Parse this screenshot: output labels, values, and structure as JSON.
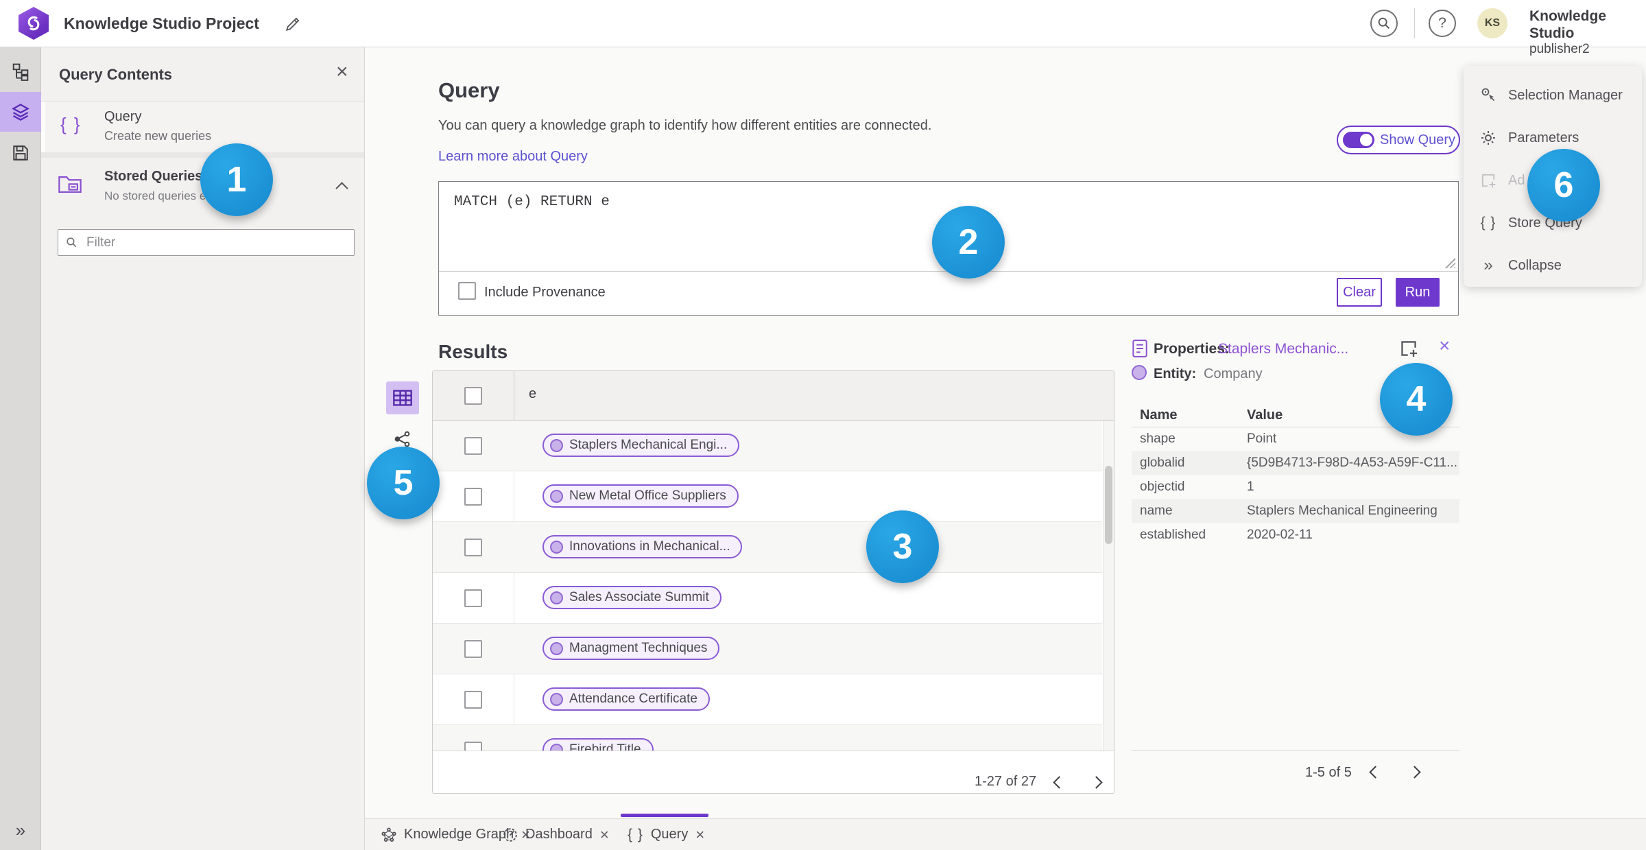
{
  "colors": {
    "accent_purple": "#6e38cc",
    "entity_purple": "#8a4fd0",
    "link_purple": "#5c52d0",
    "badge_blue": "#1e97dc",
    "avatar_yellow": "#eee9c2",
    "rail_active_bg": "#c7b0ef"
  },
  "topbar": {
    "title": "Knowledge Studio Project",
    "user_initials": "KS",
    "user_name": "Knowledge Studio",
    "user_role": "publisher2"
  },
  "contents_panel": {
    "title": "Query Contents",
    "close": "×",
    "query_label": "Query",
    "query_sublabel": "Create new queries",
    "braces_glyph": "{ }",
    "stored_label": "Stored Queries",
    "stored_sublabel": "No stored queries exist",
    "filter_placeholder": "Filter"
  },
  "query": {
    "heading": "Query",
    "description": "You can query a knowledge graph to identify how different entities are connected.",
    "learn_more": "Learn more about Query",
    "show_query": "Show Query",
    "code": "MATCH (e) RETURN e",
    "include_provenance": "Include Provenance",
    "clear": "Clear",
    "run": "Run"
  },
  "results": {
    "heading": "Results",
    "column": "e",
    "rows": [
      "Staplers Mechanical Engi...",
      "New Metal Office Suppliers",
      "Innovations in Mechanical...",
      "Sales Associate Summit",
      "Managment Techniques",
      "Attendance Certificate",
      "Firebird Title"
    ],
    "pagination": "1-27 of 27"
  },
  "properties": {
    "label": "Properties:",
    "link": "Staplers Mechanic...",
    "close": "×",
    "entity_label": "Entity:",
    "entity_value": "Company",
    "col_name": "Name",
    "col_value": "Value",
    "rows": [
      {
        "name": "shape",
        "value": "Point"
      },
      {
        "name": "globalid",
        "value": "{5D9B4713-F98D-4A53-A59F-C11..."
      },
      {
        "name": "objectid",
        "value": "1"
      },
      {
        "name": "name",
        "value": "Staplers Mechanical Engineering"
      },
      {
        "name": "established",
        "value": "2020-02-11"
      }
    ],
    "pagination": "1-5 of 5"
  },
  "right_menu": {
    "items": [
      {
        "label": "Selection Manager"
      },
      {
        "label": "Parameters"
      },
      {
        "label": "Ad"
      },
      {
        "label": "Store Query"
      },
      {
        "label": "Collapse"
      }
    ],
    "braces_glyph": "{ }",
    "collapse_glyph": "»"
  },
  "rail": {
    "expand_glyph": "»"
  },
  "tabs": [
    {
      "label": "Knowledge Graph",
      "close": "×"
    },
    {
      "label": "Dashboard",
      "close": "×"
    },
    {
      "label": "Query",
      "close": "×"
    }
  ],
  "badges": [
    "1",
    "2",
    "3",
    "4",
    "5",
    "6"
  ]
}
